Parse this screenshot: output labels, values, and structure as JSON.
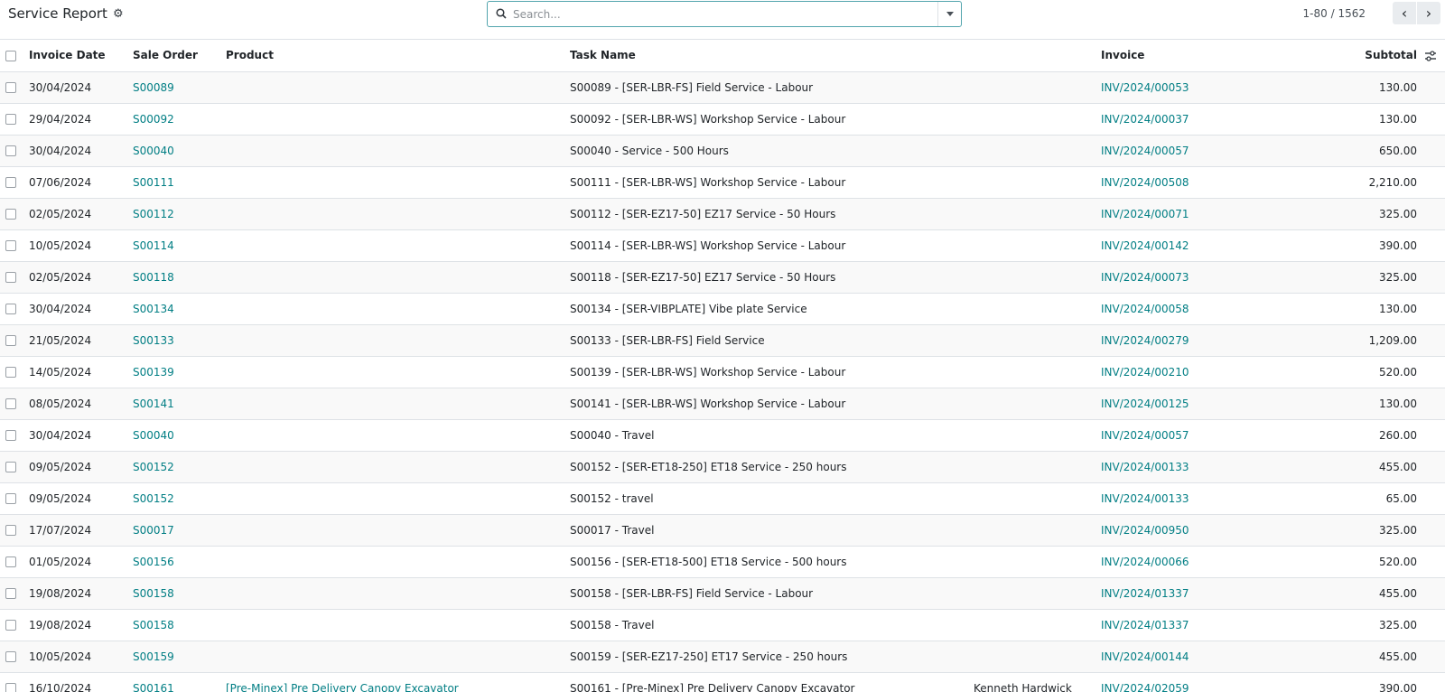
{
  "header": {
    "title": "Service Report",
    "gear_icon": "gear-icon",
    "search_placeholder": "Search...",
    "pager": "1-80 / 1562",
    "prev_glyph": "‹",
    "next_glyph": "›"
  },
  "colors": {
    "accent": "#017e84",
    "border": "#dee2e6",
    "search_border": "#52a5ad"
  },
  "columns": {
    "invoice_date": "Invoice Date",
    "sale_order": "Sale Order",
    "product": "Product",
    "task_name": "Task Name",
    "customer": "",
    "invoice": "Invoice",
    "subtotal": "Subtotal"
  },
  "rows": [
    {
      "date": "30/04/2024",
      "so": "S00089",
      "product": "",
      "task": "S00089 - [SER-LBR-FS] Field Service - Labour",
      "customer": "",
      "invoice": "INV/2024/00053",
      "subtotal": "130.00"
    },
    {
      "date": "29/04/2024",
      "so": "S00092",
      "product": "",
      "task": "S00092 - [SER-LBR-WS] Workshop Service - Labour",
      "customer": "",
      "invoice": "INV/2024/00037",
      "subtotal": "130.00"
    },
    {
      "date": "30/04/2024",
      "so": "S00040",
      "product": "",
      "task": "S00040 - Service - 500 Hours",
      "customer": "",
      "invoice": "INV/2024/00057",
      "subtotal": "650.00"
    },
    {
      "date": "07/06/2024",
      "so": "S00111",
      "product": "",
      "task": "S00111 - [SER-LBR-WS] Workshop Service - Labour",
      "customer": "",
      "invoice": "INV/2024/00508",
      "subtotal": "2,210.00"
    },
    {
      "date": "02/05/2024",
      "so": "S00112",
      "product": "",
      "task": "S00112 - [SER-EZ17-50] EZ17 Service - 50 Hours",
      "customer": "",
      "invoice": "INV/2024/00071",
      "subtotal": "325.00"
    },
    {
      "date": "10/05/2024",
      "so": "S00114",
      "product": "",
      "task": "S00114 - [SER-LBR-WS] Workshop Service - Labour",
      "customer": "",
      "invoice": "INV/2024/00142",
      "subtotal": "390.00"
    },
    {
      "date": "02/05/2024",
      "so": "S00118",
      "product": "",
      "task": "S00118 - [SER-EZ17-50] EZ17 Service - 50 Hours",
      "customer": "",
      "invoice": "INV/2024/00073",
      "subtotal": "325.00"
    },
    {
      "date": "30/04/2024",
      "so": "S00134",
      "product": "",
      "task": "S00134 - [SER-VIBPLATE] Vibe plate Service",
      "customer": "",
      "invoice": "INV/2024/00058",
      "subtotal": "130.00"
    },
    {
      "date": "21/05/2024",
      "so": "S00133",
      "product": "",
      "task": "S00133 - [SER-LBR-FS] Field Service",
      "customer": "",
      "invoice": "INV/2024/00279",
      "subtotal": "1,209.00"
    },
    {
      "date": "14/05/2024",
      "so": "S00139",
      "product": "",
      "task": "S00139 - [SER-LBR-WS] Workshop Service - Labour",
      "customer": "",
      "invoice": "INV/2024/00210",
      "subtotal": "520.00"
    },
    {
      "date": "08/05/2024",
      "so": "S00141",
      "product": "",
      "task": "S00141 - [SER-LBR-WS] Workshop Service - Labour",
      "customer": "",
      "invoice": "INV/2024/00125",
      "subtotal": "130.00"
    },
    {
      "date": "30/04/2024",
      "so": "S00040",
      "product": "",
      "task": "S00040 - Travel",
      "customer": "",
      "invoice": "INV/2024/00057",
      "subtotal": "260.00"
    },
    {
      "date": "09/05/2024",
      "so": "S00152",
      "product": "",
      "task": "S00152 - [SER-ET18-250] ET18 Service - 250 hours",
      "customer": "",
      "invoice": "INV/2024/00133",
      "subtotal": "455.00"
    },
    {
      "date": "09/05/2024",
      "so": "S00152",
      "product": "",
      "task": "S00152 - travel",
      "customer": "",
      "invoice": "INV/2024/00133",
      "subtotal": "65.00"
    },
    {
      "date": "17/07/2024",
      "so": "S00017",
      "product": "",
      "task": "S00017 - Travel",
      "customer": "",
      "invoice": "INV/2024/00950",
      "subtotal": "325.00"
    },
    {
      "date": "01/05/2024",
      "so": "S00156",
      "product": "",
      "task": "S00156 - [SER-ET18-500] ET18 Service - 500 hours",
      "customer": "",
      "invoice": "INV/2024/00066",
      "subtotal": "520.00"
    },
    {
      "date": "19/08/2024",
      "so": "S00158",
      "product": "",
      "task": "S00158 - [SER-LBR-FS] Field Service - Labour",
      "customer": "",
      "invoice": "INV/2024/01337",
      "subtotal": "455.00"
    },
    {
      "date": "19/08/2024",
      "so": "S00158",
      "product": "",
      "task": "S00158 - Travel",
      "customer": "",
      "invoice": "INV/2024/01337",
      "subtotal": "325.00"
    },
    {
      "date": "10/05/2024",
      "so": "S00159",
      "product": "",
      "task": "S00159 - [SER-EZ17-250] ET17 Service - 250 hours",
      "customer": "",
      "invoice": "INV/2024/00144",
      "subtotal": "455.00"
    },
    {
      "date": "16/10/2024",
      "so": "S00161",
      "product": "[Pre-Minex] Pre Delivery Canopy Excavator",
      "task": "S00161 - [Pre-Minex] Pre Delivery Canopy Excavator",
      "customer": "Kenneth Hardwick",
      "invoice": "INV/2024/02059",
      "subtotal": "390.00"
    }
  ]
}
